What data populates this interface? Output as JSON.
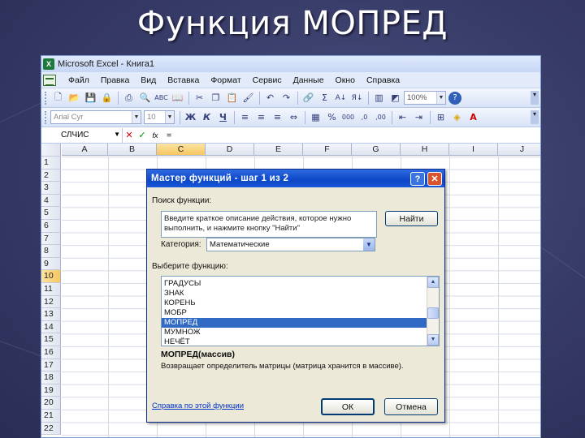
{
  "slide": {
    "title": "Функция МОПРЕД"
  },
  "excel": {
    "window_title": "Microsoft Excel - Книга1",
    "app_icon": "excel-icon",
    "menu": [
      "Файл",
      "Правка",
      "Вид",
      "Вставка",
      "Формат",
      "Сервис",
      "Данные",
      "Окно",
      "Справка"
    ],
    "toolbar": {
      "zoom": "100%",
      "font_name": "Arial Cyr",
      "font_size": "10",
      "bold": "Ж",
      "italic": "К",
      "underline": "Ч",
      "percent": "%",
      "thousands": "000",
      "autosum": "Σ"
    },
    "formula_bar": {
      "name_box": "СЛЧИС",
      "cancel_icon": "✕",
      "enter_icon": "✓",
      "fx_icon": "fx",
      "content": "="
    },
    "columns": [
      "A",
      "B",
      "C",
      "D",
      "E",
      "F",
      "G",
      "H",
      "I",
      "J"
    ],
    "selected_column": "C",
    "rows": [
      "1",
      "2",
      "3",
      "4",
      "5",
      "6",
      "7",
      "8",
      "9",
      "10",
      "11",
      "12",
      "13",
      "14",
      "15",
      "16",
      "17",
      "18",
      "19",
      "20",
      "21",
      "22"
    ],
    "selected_row": "10"
  },
  "dialog": {
    "title": "Мастер функций - шаг 1 из 2",
    "help_button": "?",
    "close_button": "✕",
    "search_label": "Поиск функции:",
    "search_text": "Введите краткое описание действия, которое нужно выполнить, и нажмите кнопку \"Найти\"",
    "find_button": "Найти",
    "category_label": "Категория:",
    "category_value": "Математические",
    "choose_label": "Выберите функцию:",
    "functions": [
      "ГРАДУСЫ",
      "ЗНАК",
      "КОРЕНЬ",
      "МОБР",
      "МОПРЕД",
      "МУМНОЖ",
      "НЕЧЁТ"
    ],
    "selected_function": "МОПРЕД",
    "signature": "МОПРЕД(массив)",
    "description": "Возвращает определитель матрицы (матрица хранится в массиве).",
    "help_link": "Справка по этой функции",
    "ok_button": "ОК",
    "cancel_button": "Отмена"
  }
}
